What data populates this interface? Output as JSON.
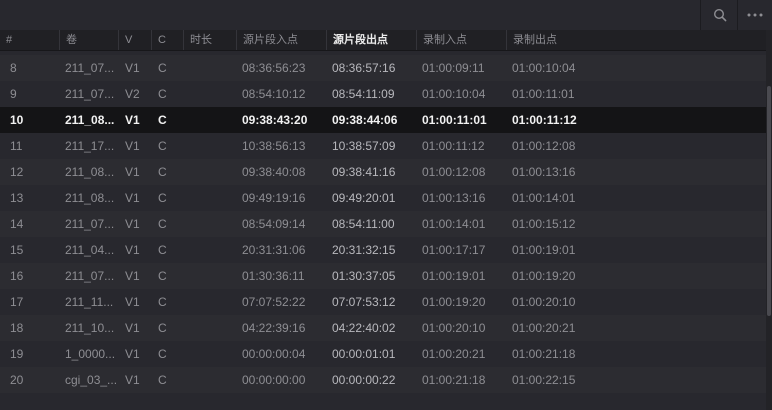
{
  "toolbar": {
    "search_icon": "search-icon",
    "more_icon": "more-options-icon"
  },
  "columns": [
    {
      "key": "num",
      "label": "#"
    },
    {
      "key": "reel",
      "label": "卷"
    },
    {
      "key": "v",
      "label": "V"
    },
    {
      "key": "c",
      "label": "C"
    },
    {
      "key": "dur",
      "label": "时长"
    },
    {
      "key": "src_in",
      "label": "源片段入点"
    },
    {
      "key": "src_out",
      "label": "源片段出点"
    },
    {
      "key": "rec_in",
      "label": "录制入点"
    },
    {
      "key": "rec_out",
      "label": "录制出点"
    }
  ],
  "sorted_column": "src_out",
  "selected_row": "10",
  "rows": [
    {
      "num": "8",
      "reel": "211_07...",
      "v": "V1",
      "c": "C",
      "dur": "",
      "src_in": "08:36:56:23",
      "src_out": "08:36:57:16",
      "rec_in": "01:00:09:11",
      "rec_out": "01:00:10:04"
    },
    {
      "num": "9",
      "reel": "211_07...",
      "v": "V2",
      "c": "C",
      "dur": "",
      "src_in": "08:54:10:12",
      "src_out": "08:54:11:09",
      "rec_in": "01:00:10:04",
      "rec_out": "01:00:11:01"
    },
    {
      "num": "10",
      "reel": "211_08...",
      "v": "V1",
      "c": "C",
      "dur": "",
      "src_in": "09:38:43:20",
      "src_out": "09:38:44:06",
      "rec_in": "01:00:11:01",
      "rec_out": "01:00:11:12"
    },
    {
      "num": "11",
      "reel": "211_17...",
      "v": "V1",
      "c": "C",
      "dur": "",
      "src_in": "10:38:56:13",
      "src_out": "10:38:57:09",
      "rec_in": "01:00:11:12",
      "rec_out": "01:00:12:08"
    },
    {
      "num": "12",
      "reel": "211_08...",
      "v": "V1",
      "c": "C",
      "dur": "",
      "src_in": "09:38:40:08",
      "src_out": "09:38:41:16",
      "rec_in": "01:00:12:08",
      "rec_out": "01:00:13:16"
    },
    {
      "num": "13",
      "reel": "211_08...",
      "v": "V1",
      "c": "C",
      "dur": "",
      "src_in": "09:49:19:16",
      "src_out": "09:49:20:01",
      "rec_in": "01:00:13:16",
      "rec_out": "01:00:14:01"
    },
    {
      "num": "14",
      "reel": "211_07...",
      "v": "V1",
      "c": "C",
      "dur": "",
      "src_in": "08:54:09:14",
      "src_out": "08:54:11:00",
      "rec_in": "01:00:14:01",
      "rec_out": "01:00:15:12"
    },
    {
      "num": "15",
      "reel": "211_04...",
      "v": "V1",
      "c": "C",
      "dur": "",
      "src_in": "20:31:31:06",
      "src_out": "20:31:32:15",
      "rec_in": "01:00:17:17",
      "rec_out": "01:00:19:01"
    },
    {
      "num": "16",
      "reel": "211_07...",
      "v": "V1",
      "c": "C",
      "dur": "",
      "src_in": "01:30:36:11",
      "src_out": "01:30:37:05",
      "rec_in": "01:00:19:01",
      "rec_out": "01:00:19:20"
    },
    {
      "num": "17",
      "reel": "211_11...",
      "v": "V1",
      "c": "C",
      "dur": "",
      "src_in": "07:07:52:22",
      "src_out": "07:07:53:12",
      "rec_in": "01:00:19:20",
      "rec_out": "01:00:20:10"
    },
    {
      "num": "18",
      "reel": "211_10...",
      "v": "V1",
      "c": "C",
      "dur": "",
      "src_in": "04:22:39:16",
      "src_out": "04:22:40:02",
      "rec_in": "01:00:20:10",
      "rec_out": "01:00:20:21"
    },
    {
      "num": "19",
      "reel": "1_0000...",
      "v": "V1",
      "c": "C",
      "dur": "",
      "src_in": "00:00:00:04",
      "src_out": "00:00:01:01",
      "rec_in": "01:00:20:21",
      "rec_out": "01:00:21:18"
    },
    {
      "num": "20",
      "reel": "cgi_03_...",
      "v": "V1",
      "c": "C",
      "dur": "",
      "src_in": "00:00:00:00",
      "src_out": "00:00:00:22",
      "rec_in": "01:00:21:18",
      "rec_out": "01:00:22:15"
    }
  ]
}
